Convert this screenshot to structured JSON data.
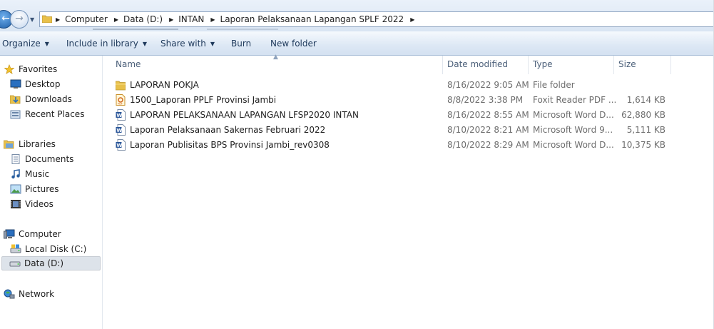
{
  "window": {
    "address_crumbs": [
      "Computer",
      "Data (D:)",
      "INTAN",
      "Laporan Pelaksanaan Lapangan SPLF 2022"
    ]
  },
  "toolbar": {
    "organize": "Organize",
    "include_in_library": "Include in library",
    "share_with": "Share with",
    "burn": "Burn",
    "new_folder": "New folder"
  },
  "sidebar": {
    "favorites": "Favorites",
    "desktop": "Desktop",
    "downloads": "Downloads",
    "recent_places": "Recent Places",
    "libraries": "Libraries",
    "documents": "Documents",
    "music": "Music",
    "pictures": "Pictures",
    "videos": "Videos",
    "computer": "Computer",
    "local_disk": "Local Disk (C:)",
    "data_drive": "Data (D:)",
    "network": "Network"
  },
  "columns": {
    "name": "Name",
    "date_modified": "Date modified",
    "type": "Type",
    "size": "Size"
  },
  "files": [
    {
      "name": "LAPORAN POKJA",
      "date": "8/16/2022 9:05 AM",
      "type": "File folder",
      "size": "",
      "icon": "folder-icon"
    },
    {
      "name": "1500_Laporan PPLF Provinsi Jambi",
      "date": "8/8/2022 3:38 PM",
      "type": "Foxit Reader PDF ...",
      "size": "1,614 KB",
      "icon": "pdf-file-icon"
    },
    {
      "name": "LAPORAN PELAKSANAAN LAPANGAN LFSP2020 INTAN",
      "date": "8/16/2022 8:55 AM",
      "type": "Microsoft Word D...",
      "size": "62,880 KB",
      "icon": "word-file-icon"
    },
    {
      "name": "Laporan Pelaksanaan Sakernas Februari 2022",
      "date": "8/10/2022 8:21 AM",
      "type": "Microsoft Word 9...",
      "size": "5,111 KB",
      "icon": "word-file-icon"
    },
    {
      "name": "Laporan Publisitas BPS Provinsi Jambi_rev0308",
      "date": "8/10/2022 8:29 AM",
      "type": "Microsoft Word D...",
      "size": "10,375 KB",
      "icon": "word-file-icon"
    }
  ],
  "colors": {
    "toolbar_text": "#1e395b",
    "folder": "#e8c04a",
    "word": "#2b579a",
    "selection": "#dde3ea"
  }
}
